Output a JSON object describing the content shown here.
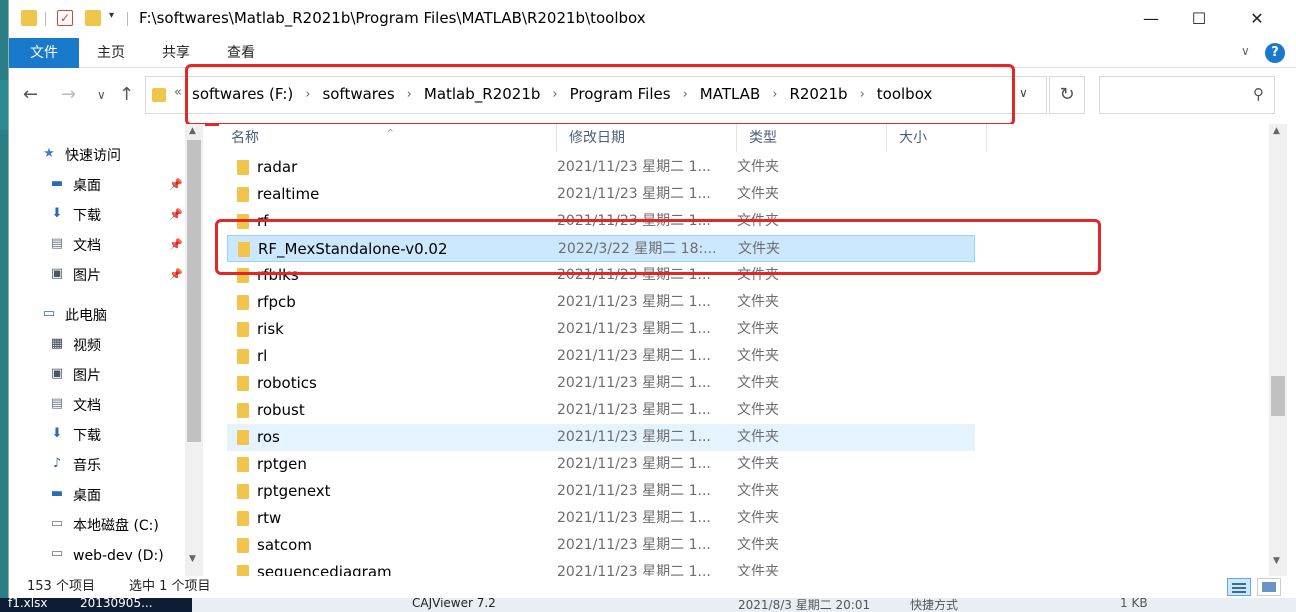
{
  "window": {
    "title_path": "F:\\softwares\\Matlab_R2021b\\Program Files\\MATLAB\\R2021b\\toolbox",
    "min_glyph": "—",
    "max_glyph": "☐",
    "close_glyph": "✕",
    "check_glyph": "✓",
    "down_caret": "▾"
  },
  "ribbon": {
    "tabs": [
      "文件",
      "主页",
      "共享",
      "查看"
    ],
    "expand_glyph": "∨",
    "help_glyph": "?"
  },
  "nav": {
    "back": "←",
    "forward": "→",
    "recent": "∨",
    "up": "↑",
    "overflow": "«",
    "breadcrumbs": [
      "softwares (F:)",
      "softwares",
      "Matlab_R2021b",
      "Program Files",
      "MATLAB",
      "R2021b",
      "toolbox"
    ],
    "crumb_sep": "›",
    "dropdown": "∨",
    "refresh_glyph": "↻",
    "search_glyph": "⚲",
    "search_placeholder": ""
  },
  "sidebar": {
    "items": [
      {
        "label": "快速访问",
        "icon": "star-icon",
        "glyph": "★",
        "color": "#3b7dd8",
        "indent": 0,
        "pinned": false
      },
      {
        "label": "桌面",
        "icon": "desktop-icon",
        "glyph": "▬",
        "color": "#2b6cb0",
        "indent": 1,
        "pinned": true
      },
      {
        "label": "下载",
        "icon": "download-icon",
        "glyph": "⬇",
        "color": "#2b6cb0",
        "indent": 1,
        "pinned": true
      },
      {
        "label": "文档",
        "icon": "document-icon",
        "glyph": "▤",
        "color": "#6b7280",
        "indent": 1,
        "pinned": true
      },
      {
        "label": "图片",
        "icon": "picture-icon",
        "glyph": "▣",
        "color": "#4b5563",
        "indent": 1,
        "pinned": true
      },
      {
        "label": "此电脑",
        "icon": "computer-icon",
        "glyph": "▭",
        "color": "#2b6cb0",
        "indent": 0,
        "pinned": false
      },
      {
        "label": "视频",
        "icon": "video-icon",
        "glyph": "▦",
        "color": "#374151",
        "indent": 1,
        "pinned": false
      },
      {
        "label": "图片",
        "icon": "picture-icon",
        "glyph": "▣",
        "color": "#4b5563",
        "indent": 1,
        "pinned": false
      },
      {
        "label": "文档",
        "icon": "document-icon",
        "glyph": "▤",
        "color": "#6b7280",
        "indent": 1,
        "pinned": false
      },
      {
        "label": "下载",
        "icon": "download-icon",
        "glyph": "⬇",
        "color": "#2b6cb0",
        "indent": 1,
        "pinned": false
      },
      {
        "label": "音乐",
        "icon": "music-icon",
        "glyph": "♪",
        "color": "#2b6cb0",
        "indent": 1,
        "pinned": false
      },
      {
        "label": "桌面",
        "icon": "desktop-icon",
        "glyph": "▬",
        "color": "#2b6cb0",
        "indent": 1,
        "pinned": false
      },
      {
        "label": "本地磁盘 (C:)",
        "icon": "drive-icon",
        "glyph": "▭",
        "color": "#6b7280",
        "indent": 1,
        "pinned": false
      },
      {
        "label": "web-dev (D:)",
        "icon": "drive-icon",
        "glyph": "▭",
        "color": "#6b7280",
        "indent": 1,
        "pinned": false
      }
    ],
    "pin_glyph": "📌"
  },
  "columns": [
    "名称",
    "修改日期",
    "类型",
    "大小"
  ],
  "sort_caret": "^",
  "files": [
    {
      "name": "radar",
      "date": "2021/11/23 星期二 1...",
      "type": "文件夹",
      "state": ""
    },
    {
      "name": "realtime",
      "date": "2021/11/23 星期二 1...",
      "type": "文件夹",
      "state": ""
    },
    {
      "name": "rf",
      "date": "2021/11/23 星期二 1...",
      "type": "文件夹",
      "state": ""
    },
    {
      "name": "RF_MexStandalone-v0.02",
      "date": "2022/3/22 星期二 18:...",
      "type": "文件夹",
      "state": "selected"
    },
    {
      "name": "rfblks",
      "date": "2021/11/23 星期二 1...",
      "type": "文件夹",
      "state": ""
    },
    {
      "name": "rfpcb",
      "date": "2021/11/23 星期二 1...",
      "type": "文件夹",
      "state": ""
    },
    {
      "name": "risk",
      "date": "2021/11/23 星期二 1...",
      "type": "文件夹",
      "state": ""
    },
    {
      "name": "rl",
      "date": "2021/11/23 星期二 1...",
      "type": "文件夹",
      "state": ""
    },
    {
      "name": "robotics",
      "date": "2021/11/23 星期二 1...",
      "type": "文件夹",
      "state": ""
    },
    {
      "name": "robust",
      "date": "2021/11/23 星期二 1...",
      "type": "文件夹",
      "state": ""
    },
    {
      "name": "ros",
      "date": "2021/11/23 星期二 1...",
      "type": "文件夹",
      "state": "hover"
    },
    {
      "name": "rptgen",
      "date": "2021/11/23 星期二 1...",
      "type": "文件夹",
      "state": ""
    },
    {
      "name": "rptgenext",
      "date": "2021/11/23 星期二 1...",
      "type": "文件夹",
      "state": ""
    },
    {
      "name": "rtw",
      "date": "2021/11/23 星期二 1...",
      "type": "文件夹",
      "state": ""
    },
    {
      "name": "satcom",
      "date": "2021/11/23 星期二 1...",
      "type": "文件夹",
      "state": ""
    },
    {
      "name": "sequencediagram",
      "date": "2021/11/23 星期二 1...",
      "type": "文件夹",
      "state": ""
    }
  ],
  "status": {
    "count": "153 个项目",
    "selection": "选中 1 个项目"
  },
  "scroll": {
    "up": "▲",
    "down": "▼"
  },
  "taskbar": {
    "file1": "f1.xlsx",
    "file2": "20130905...",
    "app": "CAJViewer 7.2",
    "date": "2021/8/3 星期二 20:01",
    "type": "快捷方式",
    "size": "1 KB"
  },
  "colors": {
    "accent": "#1979ca",
    "selection": "#cce8ff",
    "annotation": "#e02828",
    "folder": "#f1c44c"
  }
}
